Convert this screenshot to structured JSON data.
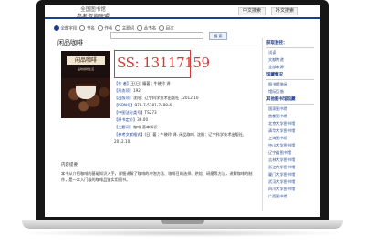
{
  "header": {
    "brand_line1": "全国图书馆",
    "brand_line2": "参考咨询联盟",
    "buttons": [
      "中文搜索",
      "外文搜索"
    ]
  },
  "search": {
    "options": [
      "全部字段",
      "书名",
      "作者",
      "主题词",
      "丛书名",
      "目次"
    ],
    "selected": "全部字段",
    "button_label": "搜 索"
  },
  "book": {
    "title": "闲品咖啡",
    "cover": {
      "heading": "闲品咖啡",
      "subtitle": "品味咖啡生活"
    },
    "ss_number": "SS: 13117159",
    "meta": [
      {
        "key": "【作 者】",
        "value": "王(日) 编著 ; 牛晓玲 译"
      },
      {
        "key": "【形态项】",
        "value": "192"
      },
      {
        "key": "【出版项】",
        "value": "沈阳：辽宁科学技术出版社 , 2012.10"
      },
      {
        "key": "【ISBN号】",
        "value": "978-7-5381-7488-6"
      },
      {
        "key": "【中图法分类号】",
        "value": "TS273"
      },
      {
        "key": "【原书定价】",
        "value": "36.00"
      },
      {
        "key": "【主题词】",
        "value": "咖啡-基本知识"
      },
      {
        "key": "【参考文献格式】",
        "value": "(日) 著 ; 牛晓玲 译. 闲品咖啡. 沈阳：辽宁科学技术出版社,"
      },
      {
        "key": "",
        "value": "2012.10."
      }
    ],
    "summary_title": "内容提要:",
    "summary": "本书从介绍咖啡的基础知识入手，详细讲解了咖啡的冲泡方法、咖啡豆的选择、烘焙、研磨等方法，讲解咖啡的制作，是一本入门级的咖啡品鉴实用图书。"
  },
  "sidebar": {
    "heading1": "获取途径：",
    "items1": [
      "试读",
      "文献传递",
      "全部来源"
    ],
    "heading2": "馆藏情况",
    "items2": [
      "图书馆借阅",
      "馆际互借"
    ],
    "heading3": "其他图书馆馆藏",
    "items3": [
      "国家图书馆",
      "首都图书馆",
      "北京大学图书馆",
      "清华大学图书馆",
      "上海图书馆",
      "中山大学图书馆",
      "辽宁省图书馆",
      "吉林大学图书馆",
      "浙江大学图书馆",
      "厦门大学图书馆",
      "武汉大学图书馆",
      "四川大学图书馆",
      "广西图书馆"
    ]
  }
}
